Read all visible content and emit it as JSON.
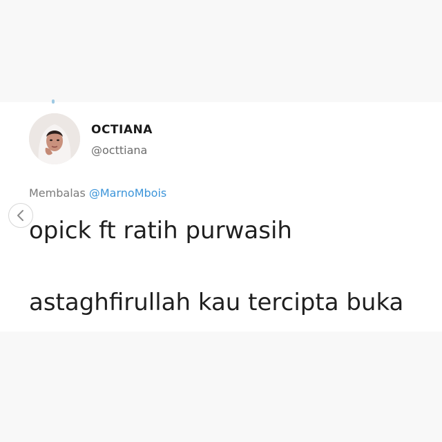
{
  "tweet": {
    "display_name": "OCTIANA",
    "handle": "@octtiana",
    "reply_prefix": "Membalas ",
    "reply_mention": "@MarnoMbois",
    "text_line_1": "opick ft ratih purwasih",
    "text_line_2": "astaghfirullah kau tercipta buka"
  },
  "carousel": {
    "prev_icon": "chevron-left-icon"
  },
  "colors": {
    "mention": "#3b94d9",
    "text": "#1f1f1f",
    "muted": "#6b6b6b"
  }
}
